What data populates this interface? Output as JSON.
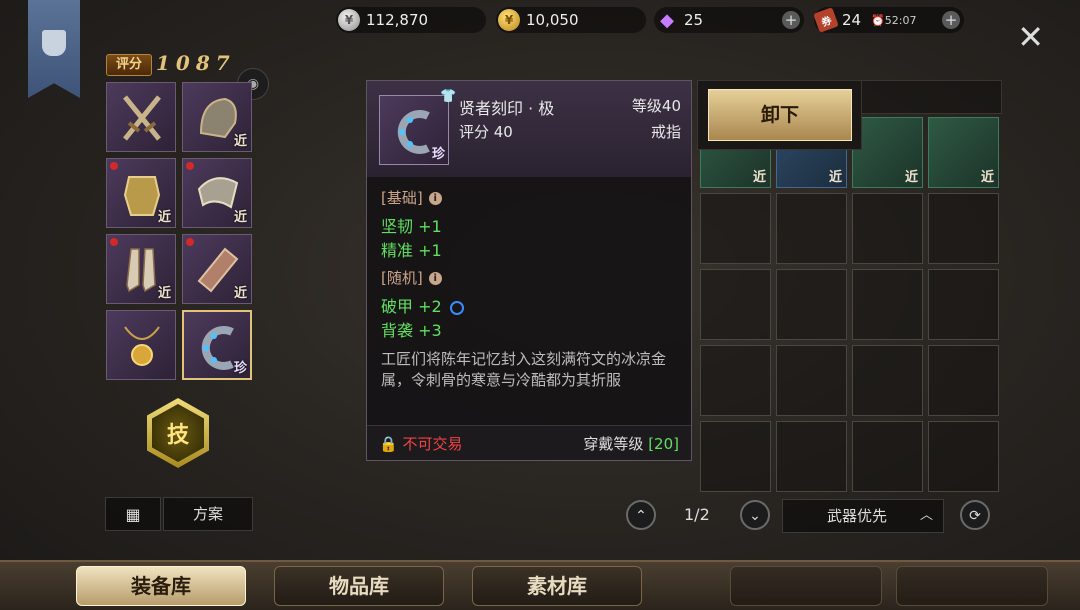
{
  "currencies": {
    "silver": {
      "value": "112,870",
      "icon": "silver-coin-icon"
    },
    "gold": {
      "value": "10,050",
      "icon": "gold-coin-icon"
    },
    "gem": {
      "value": "25",
      "icon": "diamond-icon"
    },
    "ticket": {
      "value": "24",
      "icon": "ticket-icon",
      "timer": "⏰52:07"
    },
    "plus": "+"
  },
  "close_glyph": "✕",
  "score": {
    "label": "评分",
    "value": "1087"
  },
  "equipment": {
    "near_tag": "近",
    "rare_tag": "珍",
    "skill_label": "技",
    "grid_icon": "▦",
    "plan_label": "方案"
  },
  "tooltip": {
    "name": "贤者刻印 · 极",
    "level": "等级40",
    "score": "评分 40",
    "type": "戒指",
    "basic_header": "[基础]",
    "basic_stats": [
      "坚韧 +1",
      "精准 +1"
    ],
    "random_header": "[随机]",
    "random_stats": [
      "破甲 +2",
      "背袭 +3"
    ],
    "description": "工匠们将陈年记忆封入这刻满符文的冰凉金属，令刺骨的寒意与冷酷都为其折服",
    "tradable": "不可交易",
    "wear_level_label": "穿戴等级",
    "wear_level": "[20]",
    "colors": {
      "stat": "#5fe05f",
      "locked": "#e44444",
      "section": "#c9a58a"
    }
  },
  "unequip_label": "卸下",
  "inventory": {
    "page": "1/2",
    "sort_label": "武器优先",
    "prev_glyph": "⌃",
    "next_glyph": "⌄",
    "refresh_glyph": "⟳"
  },
  "tabs": [
    "装备库",
    "物品库",
    "素材库"
  ],
  "accent_gold": "#e2c37c"
}
